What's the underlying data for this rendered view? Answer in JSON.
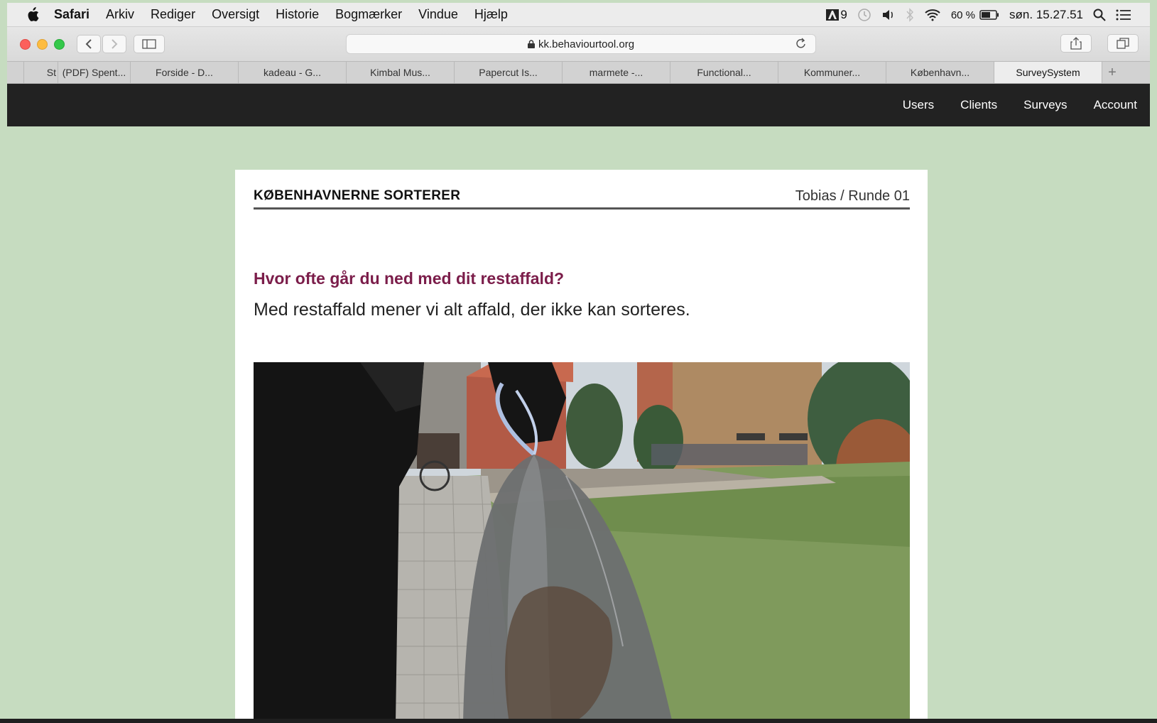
{
  "menubar": {
    "app_name": "Safari",
    "items": [
      "Arkiv",
      "Rediger",
      "Oversigt",
      "Historie",
      "Bogmærker",
      "Vindue",
      "Hjælp"
    ],
    "adobe_count": "9",
    "battery": "60 %",
    "clock": "søn. 15.27.51"
  },
  "browser": {
    "url": "kk.behaviourtool.org",
    "tabs": [
      {
        "label": "St"
      },
      {
        "label": "(PDF) Spent..."
      },
      {
        "label": "Forside - D..."
      },
      {
        "label": "kadeau - G..."
      },
      {
        "label": "Kimbal Mus..."
      },
      {
        "label": "Papercut Is..."
      },
      {
        "label": "marmete -..."
      },
      {
        "label": "Functional..."
      },
      {
        "label": "Kommuner..."
      },
      {
        "label": "København..."
      },
      {
        "label": "SurveySystem"
      }
    ],
    "active_tab_index": 10
  },
  "site_nav": {
    "users": "Users",
    "clients": "Clients",
    "surveys": "Surveys",
    "account": "Account"
  },
  "survey": {
    "brand": "KØBENHAVNERNE SORTERER",
    "user_round": "Tobias / Runde 01",
    "question": "Hvor ofte går du ned med dit restaffald?",
    "subtext": "Med restaffald mener vi alt affald, der ikke kan sorteres."
  },
  "colors": {
    "page_bg": "#c6dcc0",
    "nav_bg": "#222222",
    "question": "#7b1d4a"
  }
}
